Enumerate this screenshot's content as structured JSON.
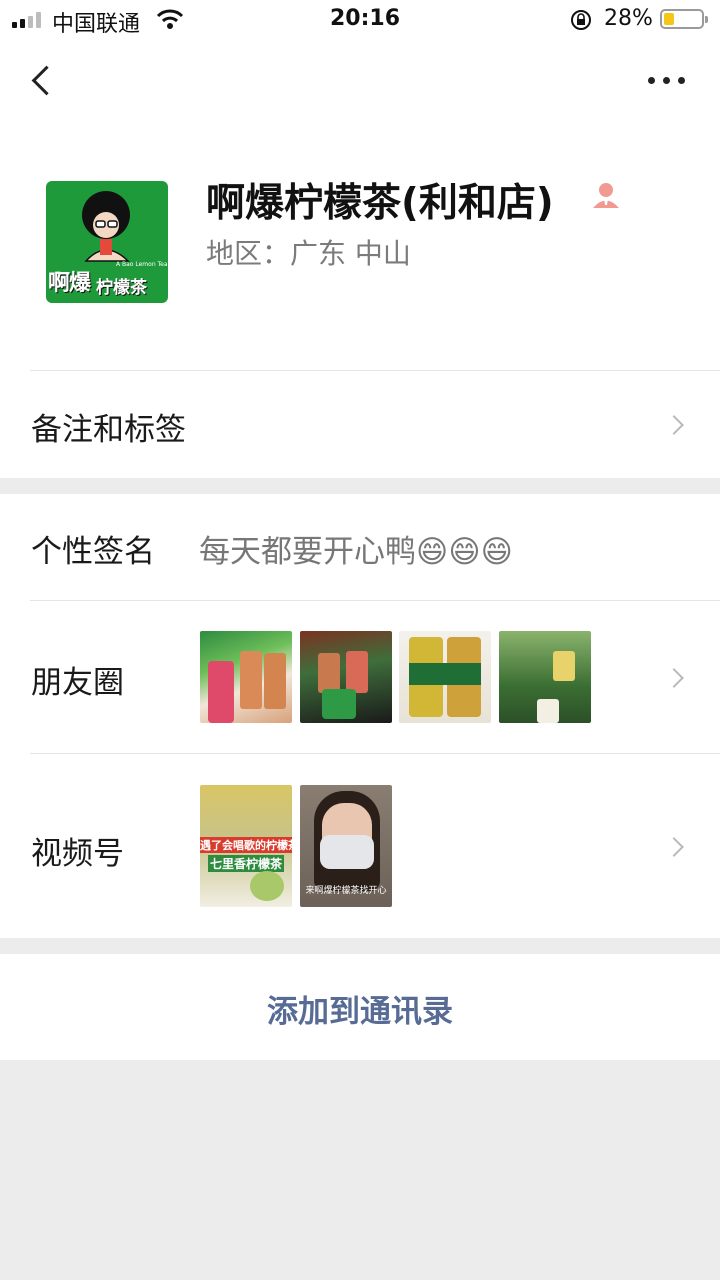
{
  "status_bar": {
    "carrier": "中国联通",
    "time": "20:16",
    "battery_percent": "28%",
    "battery_level": 0.28
  },
  "nav": {
    "back_icon": "chevron-left-icon",
    "more_icon": "more-dots-icon"
  },
  "profile": {
    "name": "啊爆柠檬茶(利和店)",
    "region_label": "地区：",
    "region_value": "广东 中山",
    "badge_icon": "enterprise-person-icon",
    "avatar_text_top": "啊爆",
    "avatar_text_bottom": "柠檬茶",
    "avatar_brand": "A Bao Lemon Tea",
    "avatar_bg": "#1f9a3b"
  },
  "rows": {
    "remark": {
      "label": "备注和标签"
    },
    "signature": {
      "label": "个性签名",
      "value": "每天都要开心鸭😄😄😄"
    },
    "moments": {
      "label": "朋友圈"
    },
    "channels": {
      "label": "视频号",
      "thumb1_top": "遇了会唱歌的柠檬茶",
      "thumb1_bottom": "七里香柠檬茶",
      "thumb2_caption": "来啊爆柠檬茶找开心"
    }
  },
  "action": {
    "add_contact": "添加到通讯录"
  },
  "colors": {
    "link": "#576b95",
    "background": "#ececec"
  }
}
